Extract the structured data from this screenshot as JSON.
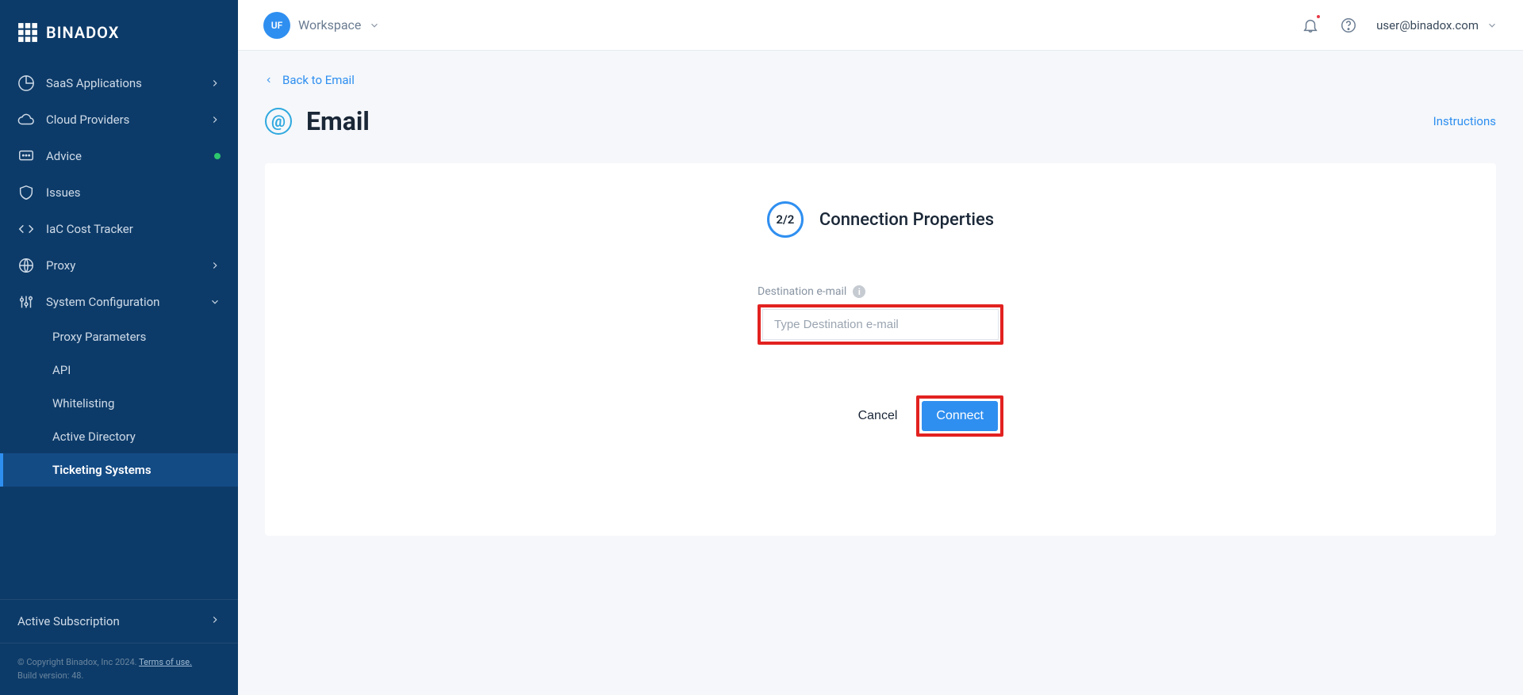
{
  "brand": {
    "name": "BINADOX"
  },
  "sidebar": {
    "items": [
      {
        "label": "SaaS Applications"
      },
      {
        "label": "Cloud Providers"
      },
      {
        "label": "Advice"
      },
      {
        "label": "Issues"
      },
      {
        "label": "IaC Cost Tracker"
      },
      {
        "label": "Proxy"
      },
      {
        "label": "System Configuration"
      }
    ],
    "subitems": [
      {
        "label": "Proxy Parameters"
      },
      {
        "label": "API"
      },
      {
        "label": "Whitelisting"
      },
      {
        "label": "Active Directory"
      },
      {
        "label": "Ticketing Systems"
      }
    ],
    "footer_link": "Active Subscription",
    "copyright_prefix": "© Copyright Binadox, Inc 2024. ",
    "terms": "Terms of use.",
    "build": "Build version: 48."
  },
  "topbar": {
    "avatar_initials": "UF",
    "workspace_label": "Workspace",
    "user_email": "user@binadox.com"
  },
  "content": {
    "back_label": "Back to Email",
    "page_title": "Email",
    "email_icon_glyph": "@",
    "instructions_label": "Instructions",
    "step_badge": "2/2",
    "step_title": "Connection Properties",
    "field_label": "Destination e-mail",
    "field_placeholder": "Type Destination e-mail",
    "cancel_label": "Cancel",
    "connect_label": "Connect"
  }
}
